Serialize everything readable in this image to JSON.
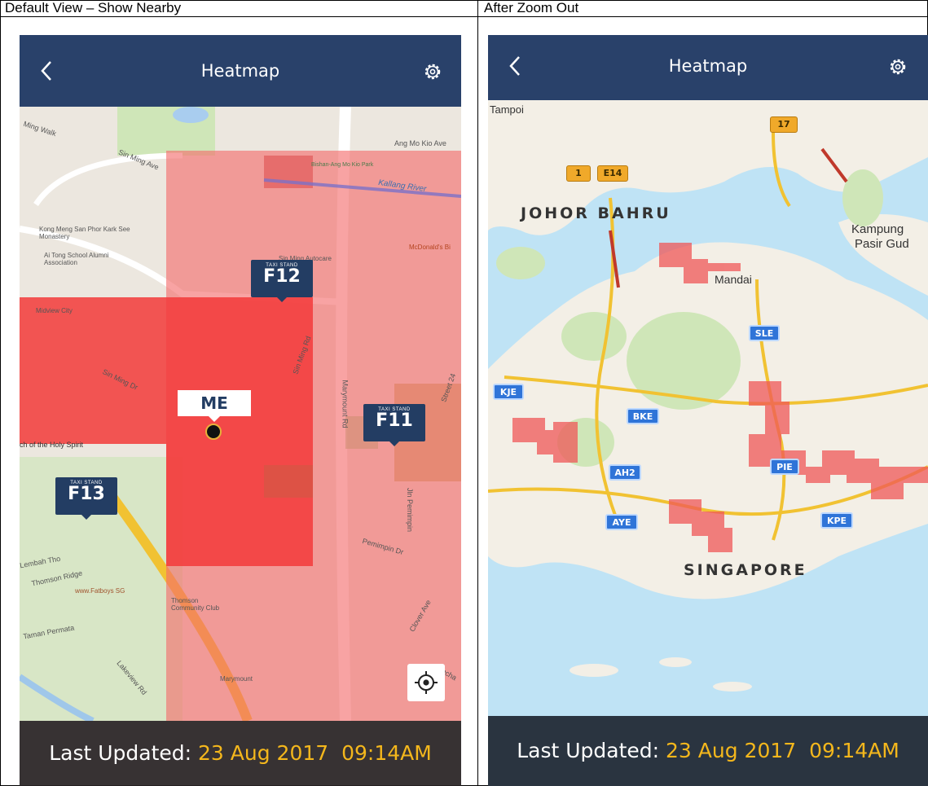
{
  "columns": {
    "left_title": "Default View – Show Nearby",
    "right_title": "After Zoom Out"
  },
  "app": {
    "title": "Heatmap",
    "back_icon": "chevron-left-icon",
    "settings_icon": "gear-icon",
    "locate_icon": "crosshair-icon"
  },
  "footer": {
    "label": "Last Updated:",
    "date": "23 Aug 2017",
    "time": "09:14AM"
  },
  "left_map": {
    "me_label": "ME",
    "taxi_stand_caption": "TAXI STAND",
    "taxi_stands": [
      "F12",
      "F11",
      "F13"
    ],
    "labels": {
      "ming_walk": "Ming Walk",
      "sin_ming_ave": "Sin Ming Ave",
      "ang_mo_kio_ave": "Ang Mo Kio Ave",
      "bishan_park": "Bishan-Ang Mo Kio Park",
      "kallang_river": "Kallang River",
      "kong_meng": "Kong Meng San Phor Kark See Monastery",
      "ai_tong": "Ai Tong School Alumni Association",
      "sin_ming_autocare": "Sin Ming Autocare",
      "mcdonalds": "McDonald's Bi",
      "midview": "Midview City",
      "sin_ming_dr": "Sin Ming Dr",
      "sin_ming_rd": "Sin Ming Rd",
      "marymount_rd": "Marymount Rd",
      "jln_pemimpin": "Jln Pemimpin",
      "pemimpin_dr": "Pemimpin Dr",
      "holy_spirit": "ch of the Holy Spirit",
      "lembah": "Lembah Tho",
      "thomson_ridge": "Thomson Ridge",
      "fatboys": "www.Fatboys SG",
      "taman_permata": "Taman Permata",
      "thomson_cc": "Thomson Community Club",
      "marymount": "Marymount",
      "lakeview": "Lakeview Rd",
      "clover_ave": "Clover Ave",
      "binchang": "Bincha",
      "street_24": "Street 24"
    }
  },
  "right_map": {
    "labels": {
      "tampoi": "Tampoi",
      "johor_bahru": "JOHOR BAHRU",
      "kampung": "Kampung",
      "pasir_gudang": "Pasir Gud",
      "mandai": "Mandai",
      "singapore": "SINGAPORE"
    },
    "shields": {
      "r1": "1",
      "e14": "E14",
      "r17": "17",
      "sle": "SLE",
      "kje": "KJE",
      "bke": "BKE",
      "ah2": "AH2",
      "aye": "AYE",
      "pie": "PIE",
      "kpe": "KPE"
    }
  }
}
